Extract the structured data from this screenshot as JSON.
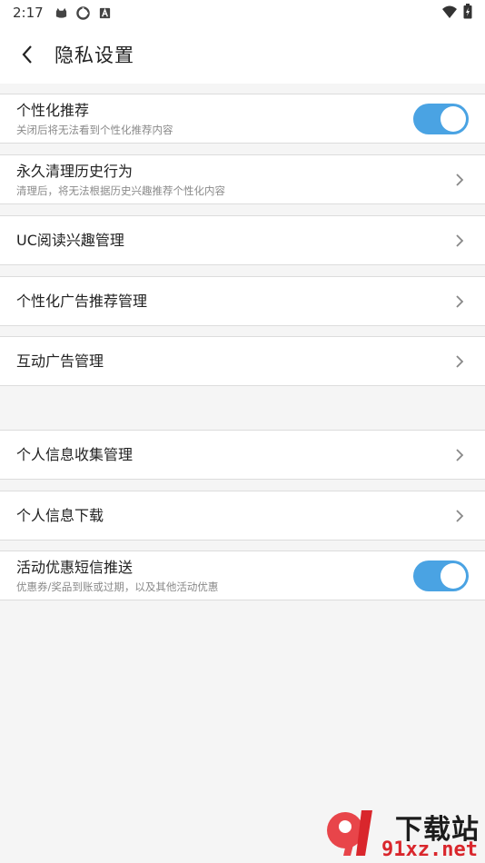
{
  "status_bar": {
    "time": "2:17",
    "left_icons": [
      "cat-icon",
      "sync-icon",
      "a-badge-icon"
    ],
    "right_icons": [
      "wifi-icon",
      "battery-charging-icon"
    ]
  },
  "header": {
    "back_icon": "chevron-left-icon",
    "title": "隐私设置"
  },
  "settings": [
    {
      "id": "personalized-recommend",
      "title": "个性化推荐",
      "subtitle": "关闭后将无法看到个性化推荐内容",
      "control": "toggle",
      "enabled": true
    },
    {
      "id": "clear-history",
      "title": "永久清理历史行为",
      "subtitle": "清理后，将无法根据历史兴趣推荐个性化内容",
      "control": "chevron"
    },
    {
      "id": "uc-reading-interest",
      "title": "UC阅读兴趣管理",
      "control": "chevron"
    },
    {
      "id": "personalized-ads",
      "title": "个性化广告推荐管理",
      "control": "chevron"
    },
    {
      "id": "interactive-ads",
      "title": "互动广告管理",
      "control": "chevron"
    },
    {
      "id": "personal-info-collection",
      "title": "个人信息收集管理",
      "control": "chevron"
    },
    {
      "id": "personal-info-download",
      "title": "个人信息下载",
      "control": "chevron"
    },
    {
      "id": "promo-sms",
      "title": "活动优惠短信推送",
      "subtitle": "优惠券/奖品到账或过期，以及其他活动优惠",
      "control": "toggle",
      "enabled": true
    }
  ],
  "colors": {
    "toggle_on": "#4aa3e3",
    "background": "#f5f5f5",
    "watermark_red": "#d9262c"
  },
  "watermark": {
    "top_text": "下载站",
    "bottom_text": "91xz.net"
  }
}
